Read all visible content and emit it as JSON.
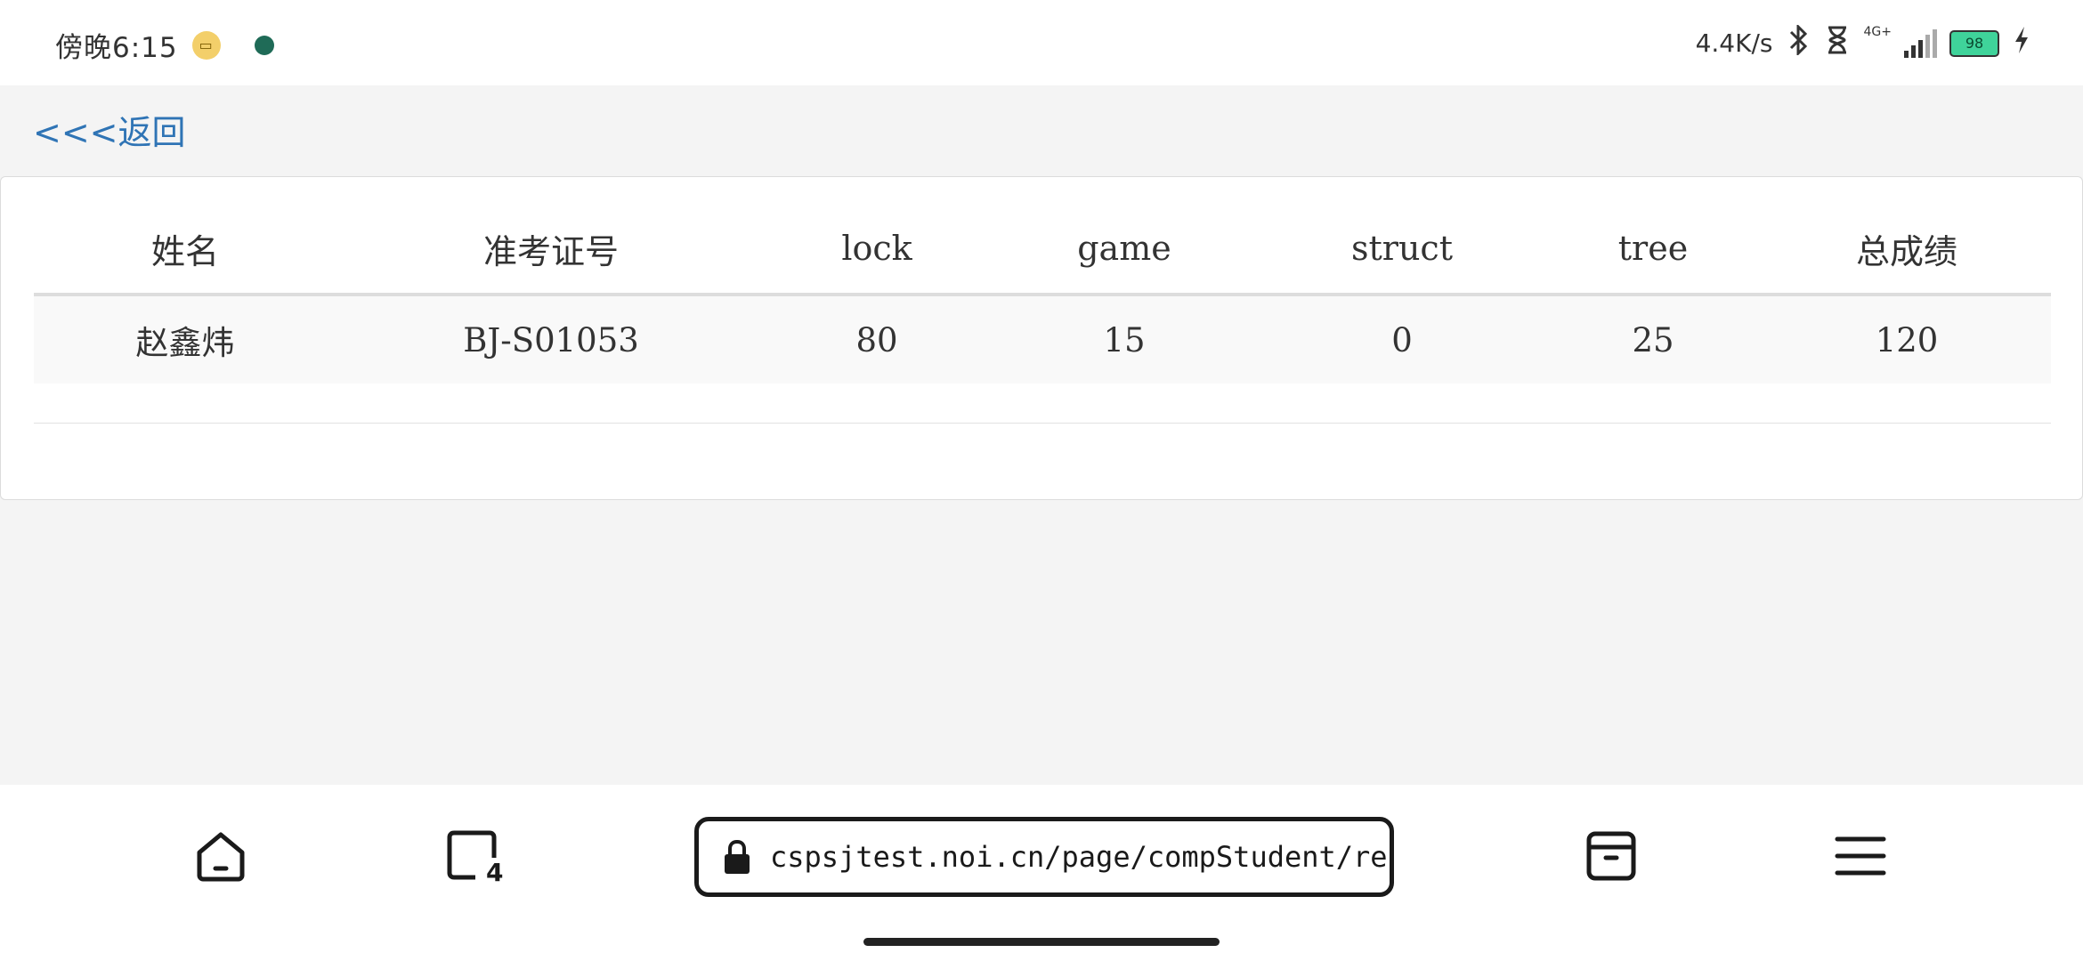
{
  "status_bar": {
    "time": "傍晚6:15",
    "network_speed": "4.4K/s",
    "network_type": "4G+",
    "battery": "98"
  },
  "back_link": "<<<返回",
  "table": {
    "headers": [
      "姓名",
      "准考证号",
      "lock",
      "game",
      "struct",
      "tree",
      "总成绩"
    ],
    "rows": [
      [
        "赵鑫炜",
        "BJ-S01053",
        "80",
        "15",
        "0",
        "25",
        "120"
      ]
    ]
  },
  "browser": {
    "url": "cspsjtest.noi.cn/page/compStudent/resultSt",
    "tab_count": "4"
  }
}
